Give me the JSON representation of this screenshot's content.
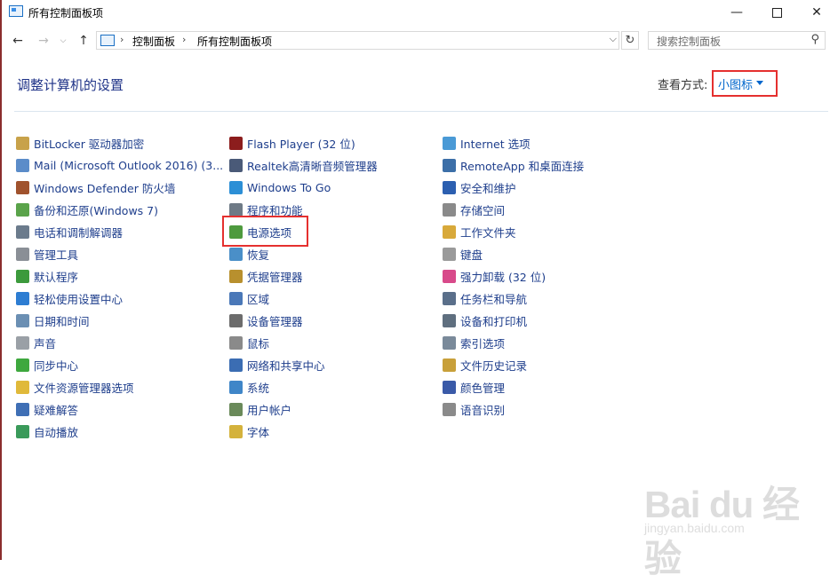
{
  "window": {
    "title": "所有控制面板项"
  },
  "nav": {
    "back": "←",
    "forward": "→",
    "up": "↑"
  },
  "address": {
    "crumbs": [
      "控制面板",
      "所有控制面板项"
    ],
    "separator": "›",
    "dropdown": "⌵",
    "refresh": "↻"
  },
  "search": {
    "placeholder": "搜索控制面板",
    "icon": "search-icon"
  },
  "header": {
    "title": "调整计算机的设置",
    "view_label": "查看方式:",
    "view_value": "小图标"
  },
  "columns": [
    [
      {
        "label": "BitLocker 驱动器加密",
        "icon": "bitlocker-icon",
        "color": "#c8a24a"
      },
      {
        "label": "Mail (Microsoft Outlook 2016) (3...",
        "icon": "mail-icon",
        "color": "#5b8cc9"
      },
      {
        "label": "Windows Defender 防火墙",
        "icon": "firewall-icon",
        "color": "#a0522d"
      },
      {
        "label": "备份和还原(Windows 7)",
        "icon": "backup-icon",
        "color": "#5aa34a"
      },
      {
        "label": "电话和调制解调器",
        "icon": "phone-modem-icon",
        "color": "#6b7b8c"
      },
      {
        "label": "管理工具",
        "icon": "admin-tools-icon",
        "color": "#8a8f96"
      },
      {
        "label": "默认程序",
        "icon": "default-programs-icon",
        "color": "#3c9a3c"
      },
      {
        "label": "轻松使用设置中心",
        "icon": "ease-of-access-icon",
        "color": "#2d7dd2"
      },
      {
        "label": "日期和时间",
        "icon": "clock-icon",
        "color": "#6b8fb3"
      },
      {
        "label": "声音",
        "icon": "speaker-icon",
        "color": "#9aa0a6"
      },
      {
        "label": "同步中心",
        "icon": "sync-icon",
        "color": "#3ea83e"
      },
      {
        "label": "文件资源管理器选项",
        "icon": "folder-options-icon",
        "color": "#e0b93a"
      },
      {
        "label": "疑难解答",
        "icon": "troubleshoot-icon",
        "color": "#3f6fb5"
      },
      {
        "label": "自动播放",
        "icon": "autoplay-icon",
        "color": "#3a9a5a"
      }
    ],
    [
      {
        "label": "Flash Player (32 位)",
        "icon": "flash-icon",
        "color": "#8c1d1d"
      },
      {
        "label": "Realtek高清晰音频管理器",
        "icon": "realtek-audio-icon",
        "color": "#4a5a78"
      },
      {
        "label": "Windows To Go",
        "icon": "windows-to-go-icon",
        "color": "#2c8fd6"
      },
      {
        "label": "程序和功能",
        "icon": "programs-icon",
        "color": "#6e7a86"
      },
      {
        "label": "电源选项",
        "icon": "power-options-icon",
        "color": "#4e9a3e"
      },
      {
        "label": "恢复",
        "icon": "recovery-icon",
        "color": "#4a8fc8"
      },
      {
        "label": "凭据管理器",
        "icon": "credential-icon",
        "color": "#b8902e"
      },
      {
        "label": "区域",
        "icon": "region-icon",
        "color": "#4a78b8"
      },
      {
        "label": "设备管理器",
        "icon": "device-manager-icon",
        "color": "#6c6c6c"
      },
      {
        "label": "鼠标",
        "icon": "mouse-icon",
        "color": "#8a8a8a"
      },
      {
        "label": "网络和共享中心",
        "icon": "network-icon",
        "color": "#3b6db3"
      },
      {
        "label": "系统",
        "icon": "system-icon",
        "color": "#3f86c8"
      },
      {
        "label": "用户帐户",
        "icon": "user-accounts-icon",
        "color": "#6a8a5a"
      },
      {
        "label": "字体",
        "icon": "fonts-icon",
        "color": "#d4b23c"
      }
    ],
    [
      {
        "label": "Internet 选项",
        "icon": "internet-options-icon",
        "color": "#4a9ad6"
      },
      {
        "label": "RemoteApp 和桌面连接",
        "icon": "remoteapp-icon",
        "color": "#3c6fa8"
      },
      {
        "label": "安全和维护",
        "icon": "security-flag-icon",
        "color": "#2c5fb0"
      },
      {
        "label": "存储空间",
        "icon": "storage-icon",
        "color": "#8a8a8a"
      },
      {
        "label": "工作文件夹",
        "icon": "work-folders-icon",
        "color": "#d8a93a"
      },
      {
        "label": "键盘",
        "icon": "keyboard-icon",
        "color": "#9a9a9a"
      },
      {
        "label": "强力卸载 (32 位)",
        "icon": "uninstall-icon",
        "color": "#d84a8a"
      },
      {
        "label": "任务栏和导航",
        "icon": "taskbar-icon",
        "color": "#5a6f8a"
      },
      {
        "label": "设备和打印机",
        "icon": "printer-icon",
        "color": "#5f6f7f"
      },
      {
        "label": "索引选项",
        "icon": "indexing-icon",
        "color": "#7a8a9a"
      },
      {
        "label": "文件历史记录",
        "icon": "file-history-icon",
        "color": "#c8a03a"
      },
      {
        "label": "颜色管理",
        "icon": "color-management-icon",
        "color": "#3a5aa8"
      },
      {
        "label": "语音识别",
        "icon": "microphone-icon",
        "color": "#8a8a8a"
      }
    ]
  ],
  "watermark": {
    "main": "Bai du 经验",
    "sub": "jingyan.baidu.com"
  }
}
